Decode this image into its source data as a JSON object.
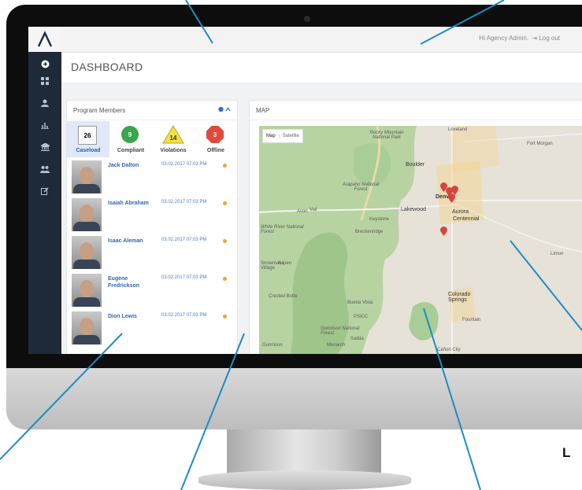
{
  "colors": {
    "sidebar": "#1e2a3a",
    "link": "#2f66b8",
    "compliant": "#3aa54b",
    "violations": "#f2e23a",
    "offline": "#e1493c",
    "pin": "#d6453d",
    "pointer": "#1e8bc3"
  },
  "topbar": {
    "greeting": "Hi Agency Admin.",
    "logout_icon": "logout-icon",
    "logout_label": "Log out"
  },
  "page": {
    "title": "DASHBOARD"
  },
  "sidebar": {
    "icons": [
      "arrow-right-icon",
      "grid-icon",
      "user-icon",
      "chart-icon",
      "bank-icon",
      "group-icon",
      "edit-icon"
    ]
  },
  "program_members": {
    "title": "Program Members",
    "tools": "❸ ^",
    "stats": [
      {
        "value": "26",
        "label": "Caseload"
      },
      {
        "value": "9",
        "label": "Compliant"
      },
      {
        "value": "14",
        "label": "Violations"
      },
      {
        "value": "3",
        "label": "Offline"
      }
    ],
    "members": [
      {
        "name": "Jack Dalton",
        "time": "03.02.2017 07:03 PM"
      },
      {
        "name": "Isaiah Abraham",
        "time": "03.02.2017 07:03 PM"
      },
      {
        "name": "Isaac Aleman",
        "time": "03.02.2017 07:03 PM"
      },
      {
        "name": "Eugene Fredrickson",
        "time": "03.02.2017 07:03 PM"
      },
      {
        "name": "Dion Lewis",
        "time": "03.02.2017 07:03 PM"
      }
    ]
  },
  "map": {
    "title": "MAP",
    "toggle": {
      "map": "Map",
      "satellite": "Satellite"
    },
    "labels": {
      "rocky": "Rocky Mountain National Park",
      "arapaho": "Arapaho National Forest",
      "whiteriver": "White River National Forest",
      "gunnison": "Gunnison National Forest",
      "psicc": "PSICC",
      "boulder": "Boulder",
      "denver": "Denver",
      "lakewood": "Lakewood",
      "aurora": "Aurora",
      "centennial": "Centennial",
      "colorado_springs": "Colorado Springs",
      "fountain": "Fountain",
      "loveland": "Loveland",
      "fort_morgan": "Fort Morgan",
      "limon": "Limon",
      "crested_butte": "Crested Butte",
      "buena_vista": "Buena Vista",
      "breckenridge": "Breckenridge",
      "keystone": "Keystone",
      "vail": "Vail",
      "avon": "Avon",
      "aspen": "Aspen",
      "snowmass": "Snowmass Village",
      "gunnison_town": "Gunnison",
      "monarch": "Monarch",
      "salida": "Salida",
      "canon_city": "Cañon City"
    },
    "pins": [
      "location-pin-icon",
      "location-pin-icon",
      "location-pin-icon",
      "location-pin-icon",
      "location-pin-icon"
    ]
  },
  "overlay": {
    "letter": "L"
  }
}
